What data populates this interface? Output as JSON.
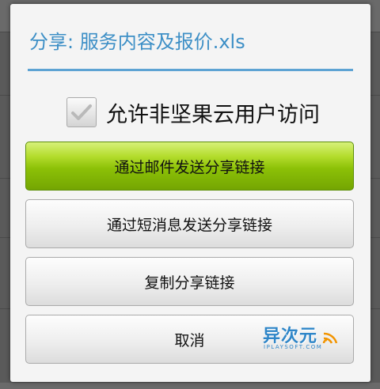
{
  "dialog": {
    "title": "分享: 服务内容及报价.xls",
    "checkbox": {
      "label": "允许非坚果云用户访问",
      "checked": true
    },
    "buttons": {
      "email": "通过邮件发送分享链接",
      "sms": "通过短消息发送分享链接",
      "copy": "复制分享链接",
      "cancel": "取消"
    },
    "watermark": {
      "name": "异次元",
      "site": "IPLAYSOFT.COM"
    }
  },
  "colors": {
    "title": "#3d8fc6",
    "primary_button": "#8cc107",
    "watermark": "#2f86c8"
  },
  "icons": [
    "checkmark-icon",
    "wifi-wave-icon"
  ]
}
